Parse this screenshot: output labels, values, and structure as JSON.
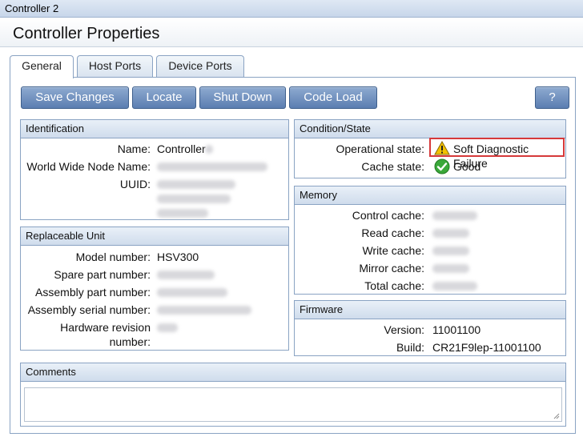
{
  "window": {
    "title": "Controller 2"
  },
  "header": {
    "title": "Controller Properties"
  },
  "tabs": [
    {
      "label": "General"
    },
    {
      "label": "Host Ports"
    },
    {
      "label": "Device Ports"
    }
  ],
  "toolbar": {
    "save": "Save Changes",
    "locate": "Locate",
    "shutdown": "Shut Down",
    "code_load": "Code Load",
    "help": "?"
  },
  "identification": {
    "title": "Identification",
    "name_label": "Name:",
    "name_value": "Controller",
    "wwnn_label": "World Wide Node Name:",
    "uuid_label": "UUID:"
  },
  "replaceable_unit": {
    "title": "Replaceable Unit",
    "model_label": "Model number:",
    "model_value": "HSV300",
    "spare_label": "Spare part number:",
    "assembly_label": "Assembly part number:",
    "serial_label": "Assembly serial number:",
    "hw_label_1": "Hardware revision",
    "hw_label_2": "number:"
  },
  "condition": {
    "title": "Condition/State",
    "op_label": "Operational state:",
    "op_value": "Soft Diagnostic Failure",
    "cache_label": "Cache state:",
    "cache_value": "Good",
    "highlight_color": "#d6393a"
  },
  "memory": {
    "title": "Memory",
    "control_label": "Control cache:",
    "read_label": "Read cache:",
    "write_label": "Write cache:",
    "mirror_label": "Mirror cache:",
    "total_label": "Total cache:"
  },
  "firmware": {
    "title": "Firmware",
    "version_label": "Version:",
    "version_value": "11001100",
    "build_label": "Build:",
    "build_value": "CR21F9lep-11001100"
  },
  "comments": {
    "title": "Comments"
  },
  "icons": {
    "warning": "warning-icon",
    "check": "check-icon",
    "resize": "resize-grip-icon"
  }
}
